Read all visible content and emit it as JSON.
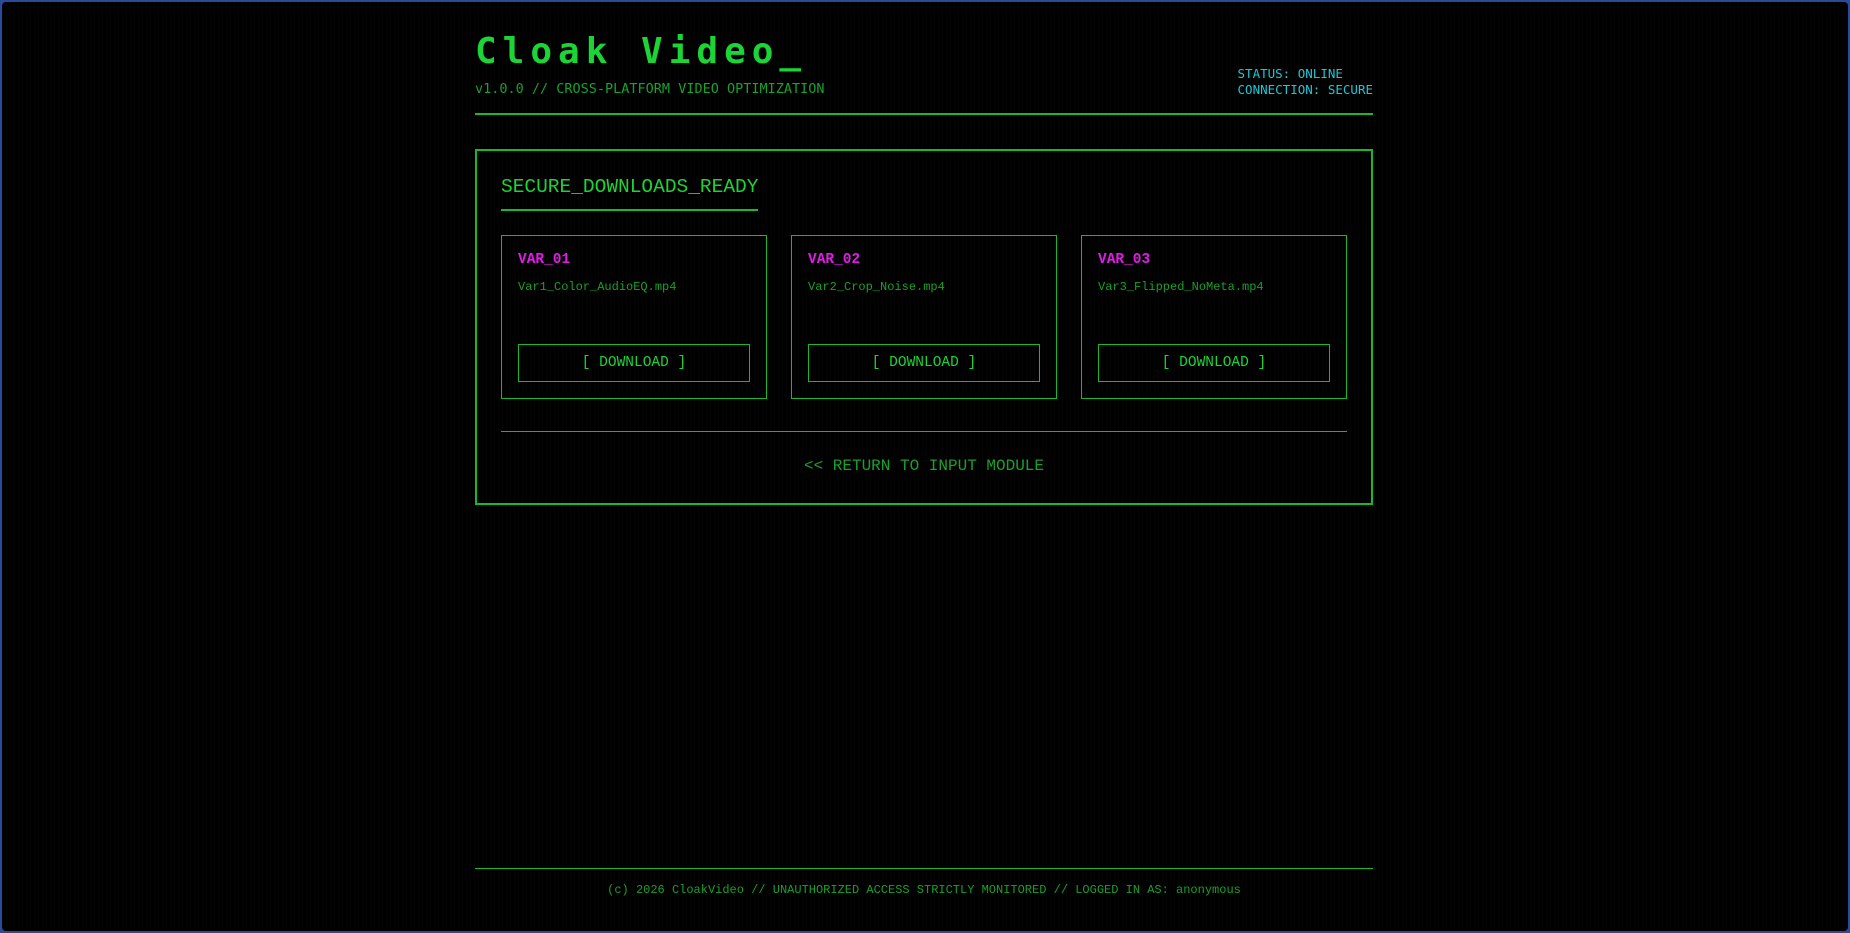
{
  "app": {
    "title": "Cloak Video_",
    "subtitle": "v1.0.0 // CROSS-PLATFORM VIDEO OPTIMIZATION"
  },
  "status": {
    "line1": "STATUS: ONLINE",
    "line2": "CONNECTION: SECURE"
  },
  "panel": {
    "title": "SECURE_DOWNLOADS_READY",
    "variants": [
      {
        "label": "VAR_01",
        "filename": "Var1_Color_AudioEQ.mp4",
        "button": "[ DOWNLOAD ]"
      },
      {
        "label": "VAR_02",
        "filename": "Var2_Crop_Noise.mp4",
        "button": "[ DOWNLOAD ]"
      },
      {
        "label": "VAR_03",
        "filename": "Var3_Flipped_NoMeta.mp4",
        "button": "[ DOWNLOAD ]"
      }
    ],
    "return_link": "<< RETURN TO INPUT MODULE"
  },
  "footer": {
    "text": "(c) 2026 CloakVideo // UNAUTHORIZED ACCESS STRICTLY MONITORED // LOGGED IN AS: anonymous"
  },
  "colors": {
    "background": "#000000",
    "primary_green": "#1bd435",
    "dim_green": "#17a02a",
    "accent_magenta": "#e01ce6",
    "accent_cyan": "#18c9d6",
    "window_frame": "#2a4a9a"
  }
}
